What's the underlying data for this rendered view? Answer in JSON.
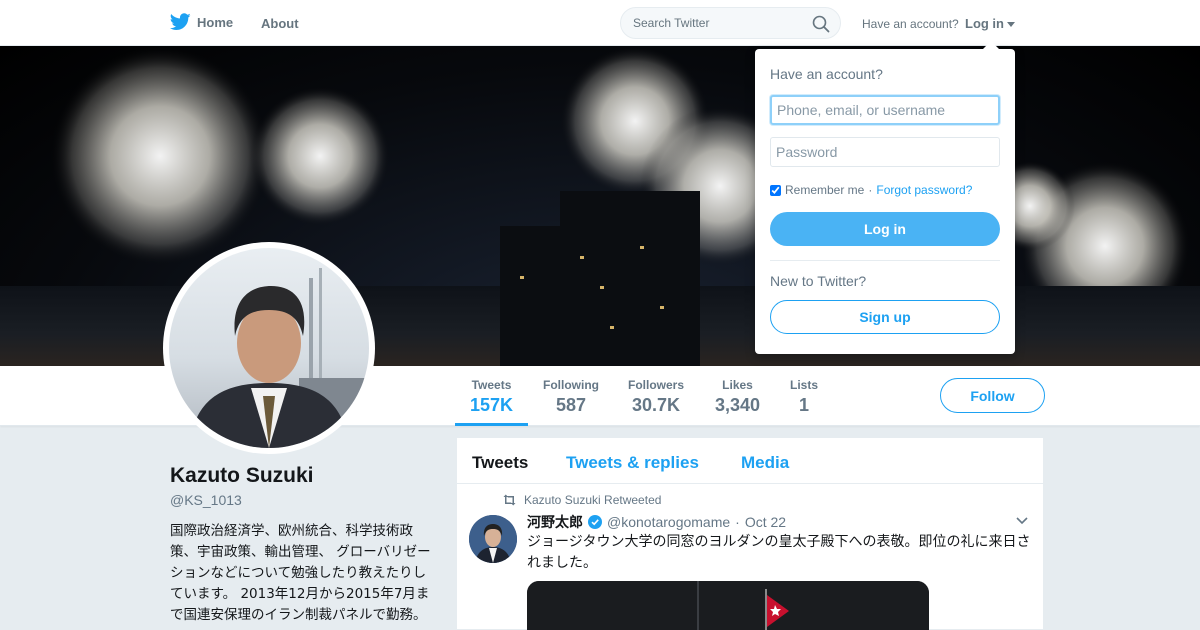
{
  "topbar": {
    "home_label": "Home",
    "about_label": "About",
    "search_placeholder": "Search Twitter",
    "have_account": "Have an account?",
    "login_label": "Log in"
  },
  "colors": {
    "accent": "#1da1f2",
    "button_fill": "#4ab3f4",
    "page_bg": "#e6ecf0"
  },
  "profile": {
    "name": "Kazuto Suzuki",
    "handle": "@KS_1013",
    "bio": "国際政治経済学、欧州統合、科学技術政策、宇宙政策、輸出管理、 グローバリゼーションなどについて勉強したり教えたりしています。 2013年12月から2015年7月まで国連安保理のイラン制裁パネルで勤務。 Sorry folks, all tweets are in"
  },
  "stats": [
    {
      "label": "Tweets",
      "value": "157K"
    },
    {
      "label": "Following",
      "value": "587"
    },
    {
      "label": "Followers",
      "value": "30.7K"
    },
    {
      "label": "Likes",
      "value": "3,340"
    },
    {
      "label": "Lists",
      "value": "1"
    }
  ],
  "follow_label": "Follow",
  "timeline": {
    "tabs": [
      "Tweets",
      "Tweets & replies",
      "Media"
    ],
    "tweet": {
      "retweet_note": "Kazuto Suzuki Retweeted",
      "name": "河野太郎",
      "username": "@konotarogomame",
      "separator": "·",
      "date": "Oct 22",
      "text": "ジョージタウン大学の同窓のヨルダンの皇太子殿下への表敬。即位の礼に来日されました。"
    }
  },
  "login_dropdown": {
    "title": "Have an account?",
    "username_placeholder": "Phone, email, or username",
    "password_placeholder": "Password",
    "remember_label": "Remember me",
    "separator": "·",
    "forgot_label": "Forgot password?",
    "login_button": "Log in",
    "new_label": "New to Twitter?",
    "signup_button": "Sign up"
  },
  "icons": {
    "logo": "twitter-bird-icon",
    "search": "search-icon",
    "retweet": "retweet-icon",
    "verified": "verified-badge-icon",
    "caret": "chevron-down-icon"
  }
}
